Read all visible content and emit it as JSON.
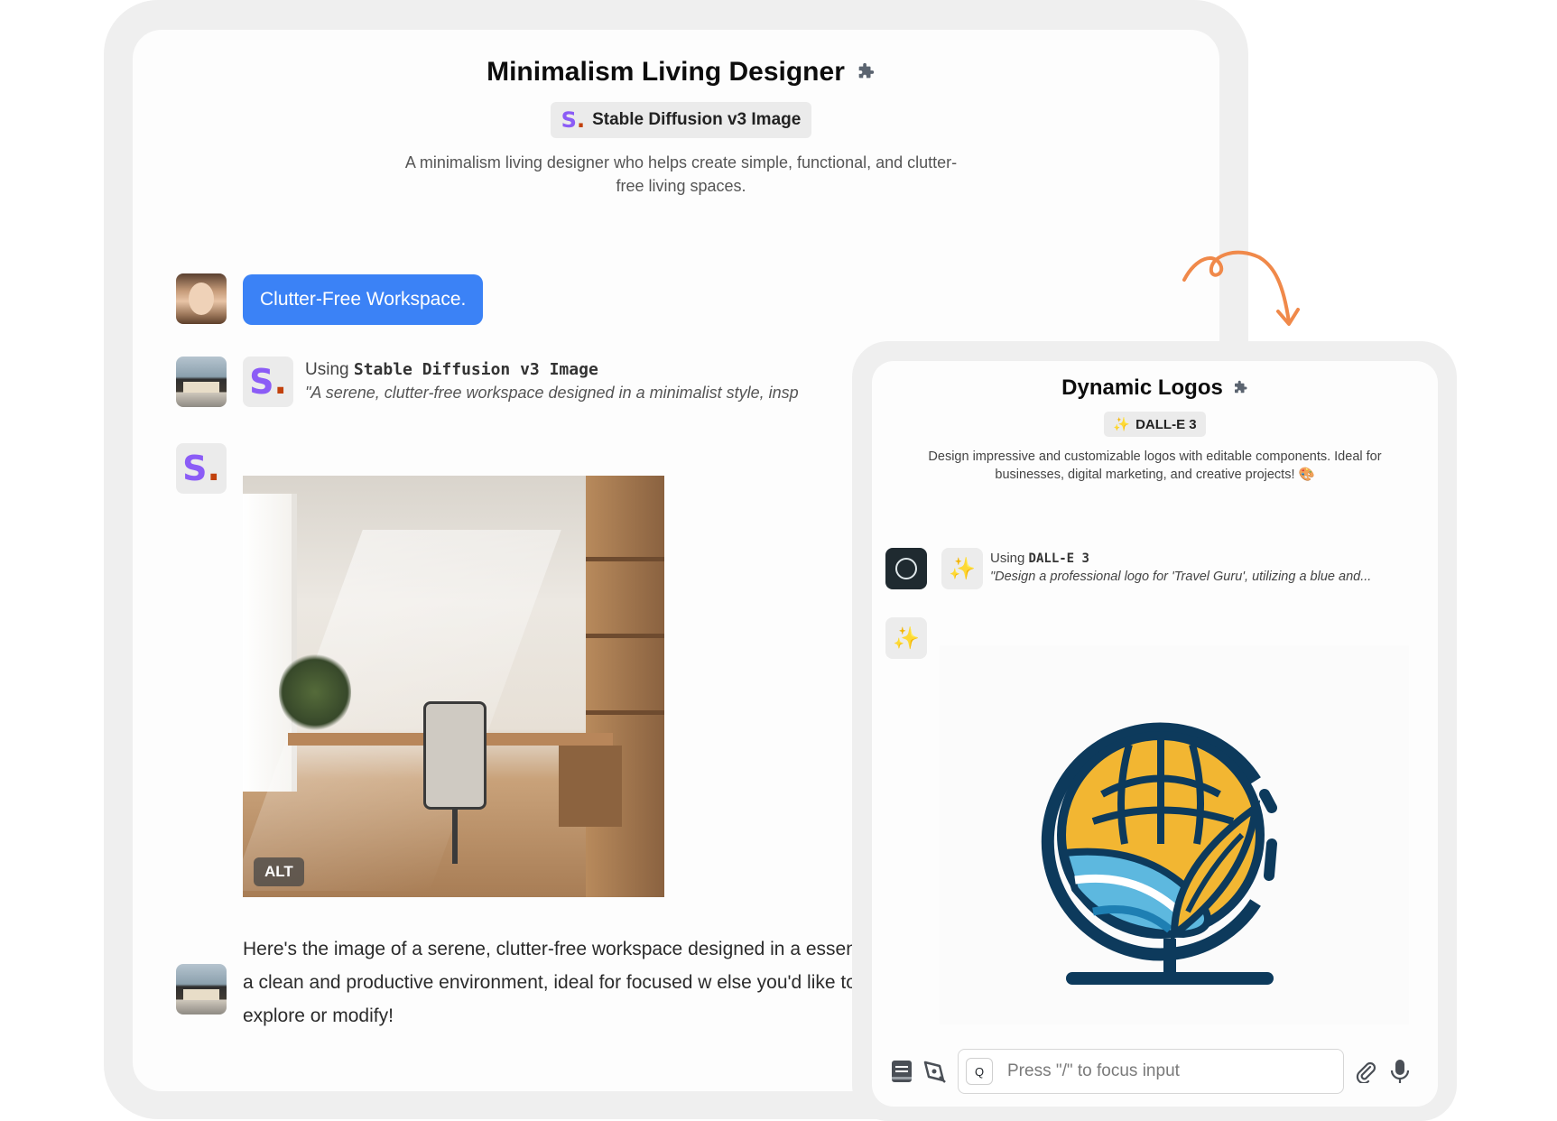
{
  "main": {
    "title": "Minimalism Living Designer",
    "model_badge": "Stable Diffusion v3 Image",
    "logo_letter": "S",
    "logo_dot": ".",
    "description": "A minimalism living designer who helps create simple, functional, and clutter-free living spaces.",
    "user_message": "Clutter-Free Workspace.",
    "tool_using_prefix": "Using",
    "tool_name": "Stable Diffusion v3 Image",
    "tool_prompt": "\"A serene, clutter-free workspace designed in a minimalist style, insp",
    "image_alt_badge": "ALT",
    "reply": "Here's the image of a serene, clutter-free workspace designed in a essence of a clean and productive environment, ideal for focused w else you'd like to explore or modify!"
  },
  "secondary": {
    "title": "Dynamic Logos",
    "model_badge_icon": "✨",
    "model_badge": "DALL-E 3",
    "description": "Design impressive and customizable logos with editable components. Ideal for businesses, digital marketing, and creative projects! 🎨",
    "tool_using_prefix": "Using",
    "tool_name": "DALL-E 3",
    "tool_prompt": "\"Design a professional logo for 'Travel Guru', utilizing a blue and...",
    "sparkle_icon": "✨",
    "input_placeholder": "Press \"/\" to focus input",
    "search_key": "Q"
  },
  "colors": {
    "accent_blue": "#3b82f6",
    "s_logo_purple": "#8b5cf6",
    "arrow_orange": "#f0894a",
    "logo_navy": "#0d3a5c",
    "logo_gold": "#f2b632"
  }
}
